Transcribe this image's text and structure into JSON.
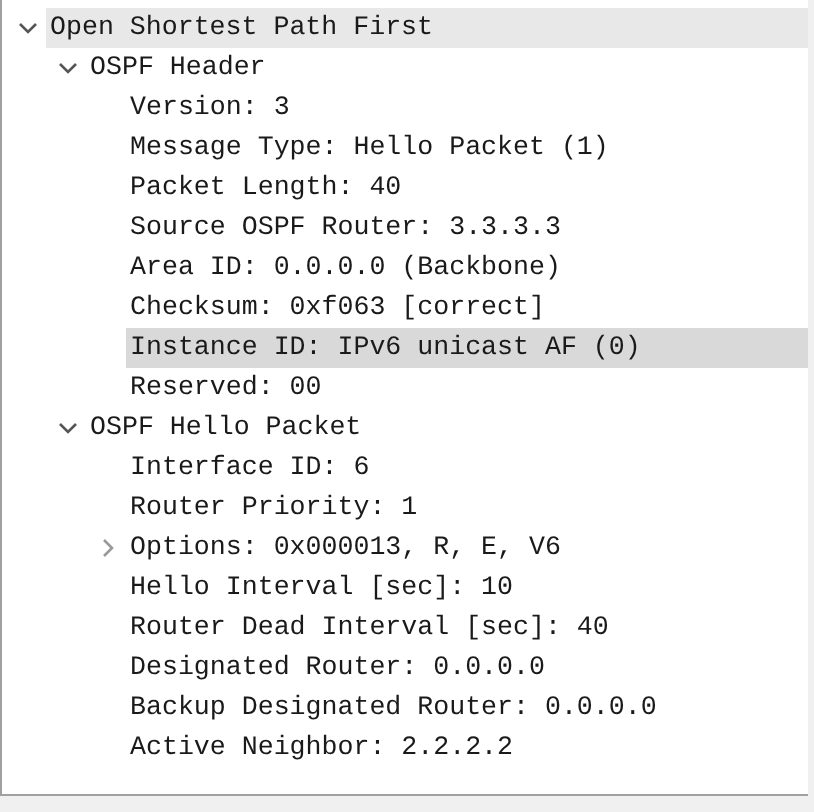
{
  "tree": [
    {
      "label": "Open Shortest Path First",
      "expanded": true,
      "selected": false,
      "hovered": true,
      "children": [
        {
          "label": "OSPF Header",
          "expanded": true,
          "selected": false,
          "hovered": false,
          "children": [
            {
              "label": "Version: 3",
              "selected": false,
              "hovered": false
            },
            {
              "label": "Message Type: Hello Packet (1)",
              "selected": false,
              "hovered": false
            },
            {
              "label": "Packet Length: 40",
              "selected": false,
              "hovered": false
            },
            {
              "label": "Source OSPF Router: 3.3.3.3",
              "selected": false,
              "hovered": false
            },
            {
              "label": "Area ID: 0.0.0.0 (Backbone)",
              "selected": false,
              "hovered": false
            },
            {
              "label": "Checksum: 0xf063 [correct]",
              "selected": false,
              "hovered": false
            },
            {
              "label": "Instance ID: IPv6 unicast AF (0)",
              "selected": true,
              "hovered": false
            },
            {
              "label": "Reserved: 00",
              "selected": false,
              "hovered": false
            }
          ]
        },
        {
          "label": "OSPF Hello Packet",
          "expanded": true,
          "selected": false,
          "hovered": false,
          "children": [
            {
              "label": "Interface ID: 6",
              "selected": false,
              "hovered": false
            },
            {
              "label": "Router Priority: 1",
              "selected": false,
              "hovered": false
            },
            {
              "label": "Options: 0x000013, R, E, V6",
              "expanded": false,
              "selected": false,
              "hovered": false
            },
            {
              "label": "Hello Interval [sec]: 10",
              "selected": false,
              "hovered": false
            },
            {
              "label": "Router Dead Interval [sec]: 40",
              "selected": false,
              "hovered": false
            },
            {
              "label": "Designated Router: 0.0.0.0",
              "selected": false,
              "hovered": false
            },
            {
              "label": "Backup Designated Router: 0.0.0.0",
              "selected": false,
              "hovered": false
            },
            {
              "label": "Active Neighbor: 2.2.2.2",
              "selected": false,
              "hovered": false
            }
          ]
        }
      ]
    }
  ]
}
